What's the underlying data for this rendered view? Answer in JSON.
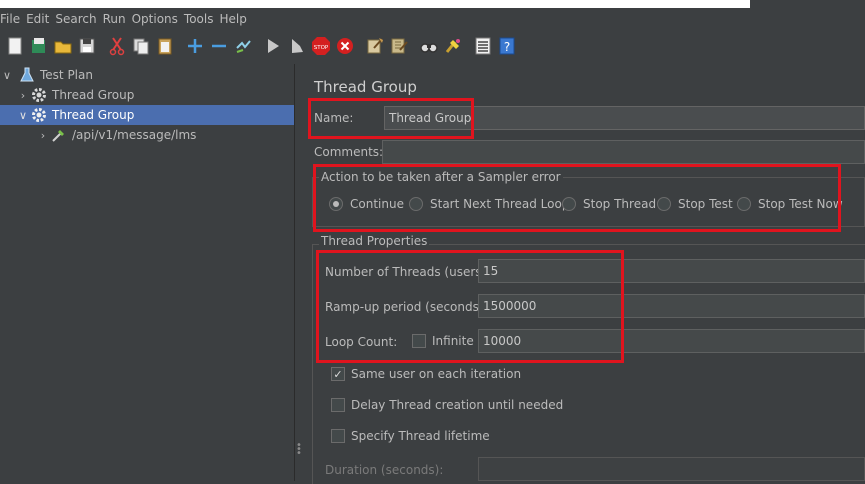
{
  "menubar": {
    "items": [
      "File",
      "Edit",
      "Search",
      "Run",
      "Options",
      "Tools",
      "Help"
    ]
  },
  "toolbar": {
    "icons": [
      "new-icon",
      "templates-icon",
      "open-icon",
      "save-icon",
      "cut-icon",
      "copy-icon",
      "paste-icon",
      "expand-icon",
      "collapse-icon",
      "toggle-icon",
      "start-icon",
      "start-no-pauses-icon",
      "stop-icon",
      "shutdown-icon",
      "clear-icon",
      "clear-all-icon",
      "search-icon",
      "reset-search-icon",
      "function-helper-icon",
      "help-icon"
    ]
  },
  "tree": {
    "items": [
      {
        "label": "Test Plan",
        "icon": "test-plan-icon",
        "expanded": true
      },
      {
        "label": "Thread Group",
        "icon": "gear-icon",
        "expanded": false
      },
      {
        "label": "Thread Group",
        "icon": "gear-icon",
        "expanded": true,
        "selected": true
      },
      {
        "label": "/api/v1/message/lms",
        "icon": "pipette-icon",
        "expanded": false
      }
    ]
  },
  "panel": {
    "title": "Thread Group",
    "name_label": "Name:",
    "name_value": "Thread Group",
    "comments_label": "Comments:",
    "comments_value": "",
    "action_group": {
      "title": "Action to be taken after a Sampler error",
      "options": [
        "Continue",
        "Start Next Thread Loop",
        "Stop Thread",
        "Stop Test",
        "Stop Test Now"
      ],
      "selected": "Continue"
    },
    "thread_props": {
      "title": "Thread Properties",
      "threads_label": "Number of Threads (users):",
      "threads_value": "15",
      "rampup_label": "Ramp-up period (seconds):",
      "rampup_value": "1500000",
      "loop_label": "Loop Count:",
      "infinite_label": "Infinite",
      "infinite_checked": false,
      "loop_value": "10000",
      "same_user_label": "Same user on each iteration",
      "same_user_checked": true,
      "delay_label": "Delay Thread creation until needed",
      "delay_checked": false,
      "lifetime_label": "Specify Thread lifetime",
      "lifetime_checked": false,
      "duration_label": "Duration (seconds):",
      "duration_value": ""
    }
  },
  "colors": {
    "background": "#3c3f41",
    "selection": "#4b6eaf",
    "highlight_box": "#e0141e"
  }
}
